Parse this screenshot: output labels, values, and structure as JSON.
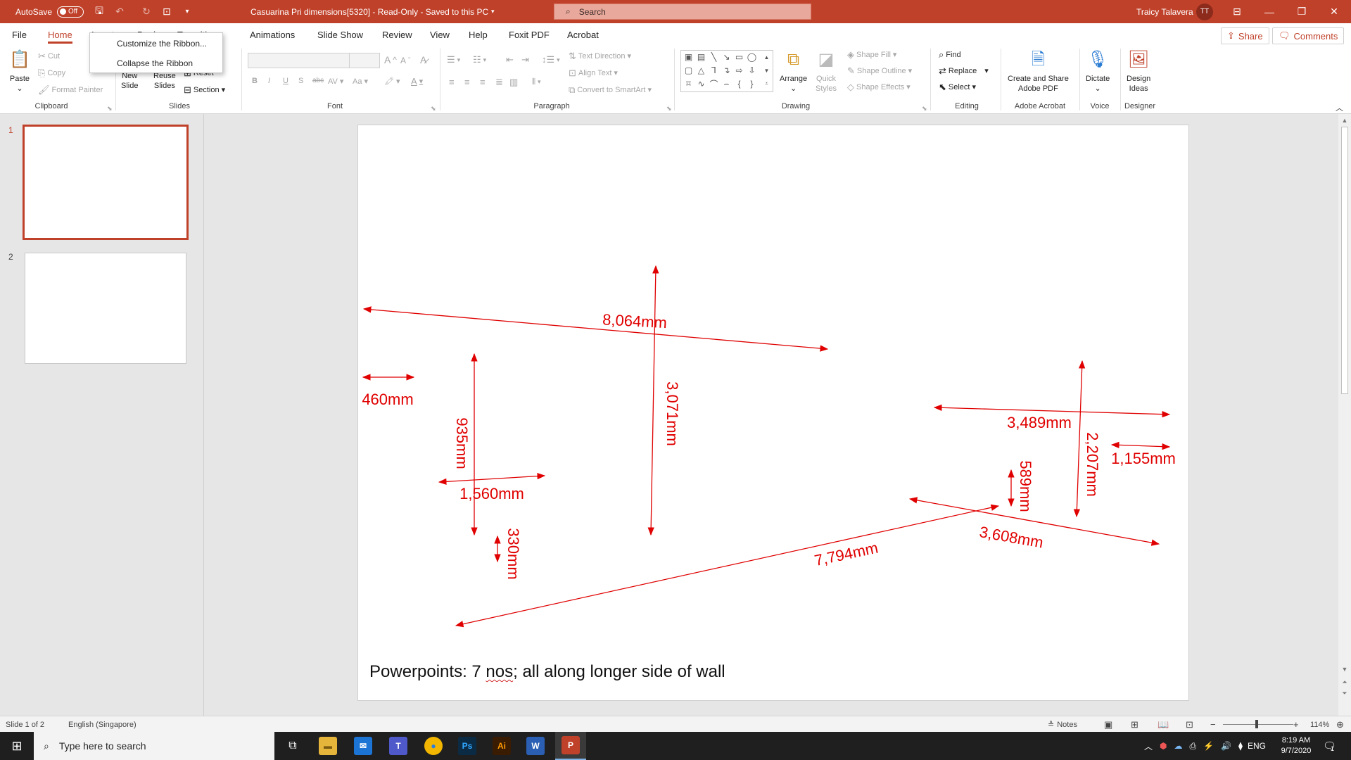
{
  "titlebar": {
    "autosave_label": "AutoSave",
    "autosave_state": "Off",
    "document_title": "Casuarina Pri dimensions[5320]  -  Read-Only  -  Saved to this PC",
    "search_placeholder": "Search",
    "user_name": "Traicy Talavera",
    "user_initials": "TT"
  },
  "tabs": [
    "File",
    "Home",
    "Insert",
    "Design",
    "Transitions",
    "Animations",
    "Slide Show",
    "Review",
    "View",
    "Help",
    "Foxit PDF",
    "Acrobat"
  ],
  "active_tab": "Home",
  "header_buttons": {
    "share": "Share",
    "comments": "Comments"
  },
  "context_menu": {
    "items": [
      "Customize the Ribbon...",
      "Collapse the Ribbon"
    ]
  },
  "ribbon": {
    "clipboard": {
      "paste": "Paste",
      "cut": "Cut",
      "copy": "Copy",
      "format_painter": "Format Painter",
      "group": "Clipboard"
    },
    "slides": {
      "new_slide_1": "New",
      "new_slide_2": "Slide",
      "reuse_1": "Reuse",
      "reuse_2": "Slides",
      "reset": "Reset",
      "section": "Section",
      "group": "Slides"
    },
    "font": {
      "group": "Font",
      "bold": "B",
      "italic": "I",
      "underline": "U",
      "shadow": "S",
      "strike": "abc",
      "spacing": "AV",
      "case": "Aa",
      "grow": "A",
      "shrink": "A"
    },
    "paragraph": {
      "group": "Paragraph",
      "text_direction": "Text Direction",
      "align_text": "Align Text",
      "convert_smartart": "Convert to SmartArt"
    },
    "drawing": {
      "group": "Drawing",
      "arrange": "Arrange",
      "quick_styles_1": "Quick",
      "quick_styles_2": "Styles",
      "shape_fill": "Shape Fill",
      "shape_outline": "Shape Outline",
      "shape_effects": "Shape Effects"
    },
    "editing": {
      "group": "Editing",
      "find": "Find",
      "replace": "Replace",
      "select": "Select"
    },
    "acrobat": {
      "group": "Adobe Acrobat",
      "create_share_1": "Create and Share",
      "create_share_2": "Adobe PDF"
    },
    "voice": {
      "group": "Voice",
      "dictate": "Dictate"
    },
    "designer": {
      "group": "Designer",
      "design_ideas_1": "Design",
      "design_ideas_2": "Ideas"
    }
  },
  "thumbnails": [
    {
      "number": "1",
      "selected": true
    },
    {
      "number": "2",
      "selected": false
    }
  ],
  "slide": {
    "dimensions": [
      "8,064mm",
      "460mm",
      "935mm",
      "1,560mm",
      "330mm",
      "3,071mm",
      "3,489mm",
      "2,207mm",
      "1,155mm",
      "589mm",
      "3,608mm",
      "7,794mm"
    ],
    "caption_a": "Powerpoints: 7 ",
    "caption_b": "nos",
    "caption_c": "; all along longer side of wall",
    "annotation_color": "#e00000"
  },
  "statusbar": {
    "slide_info": "Slide 1 of 2",
    "language": "English (Singapore)",
    "notes": "Notes",
    "zoom": "114%"
  },
  "taskbar": {
    "search_placeholder": "Type here to search",
    "language": "ENG",
    "time": "8:19 AM",
    "date": "9/7/2020",
    "notification_count": "1"
  }
}
